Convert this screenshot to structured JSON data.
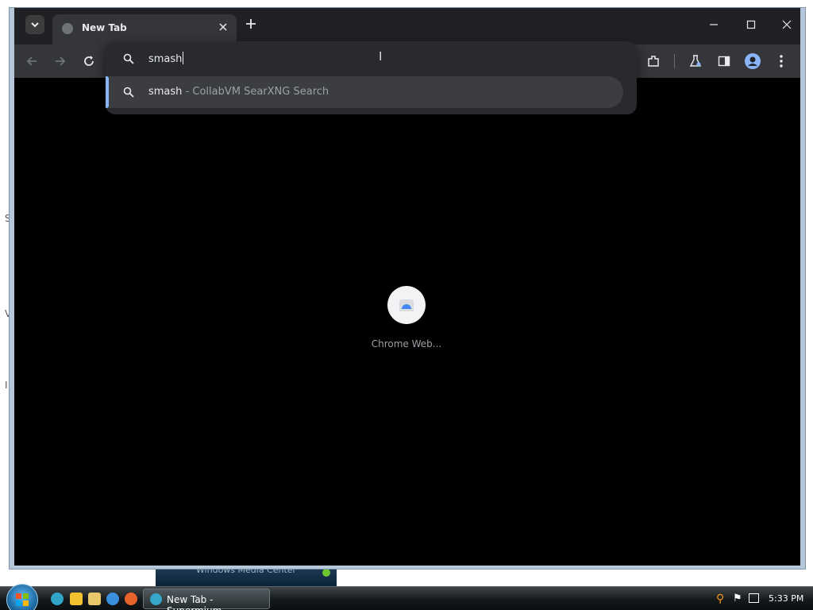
{
  "browser": {
    "tab": {
      "title": "New Tab"
    },
    "omnibox": {
      "value": "smash",
      "suggestion": {
        "query": "smash",
        "description": " - CollabVM SearXNG Search"
      }
    },
    "shortcut": {
      "label": "Chrome Web..."
    }
  },
  "desktop": {
    "edge_glyphs": [
      "S",
      "V",
      "I"
    ],
    "wmc_text": "Windows Media Center"
  },
  "taskbar": {
    "task_button": "New Tab - Supermium",
    "clock": "5:33 PM"
  },
  "colors": {
    "tabstrip": "#202124",
    "toolbar": "#35363a",
    "omnibox": "#282a2d",
    "suggestion_highlight": "#3c3d41",
    "accent": "#8ab4f8",
    "content": "#000000"
  },
  "icons": [
    "tab-search-icon",
    "globe-icon",
    "close-icon",
    "plus-icon",
    "minimize-icon",
    "maximize-icon",
    "back-icon",
    "forward-icon",
    "reload-icon",
    "search-icon",
    "extensions-icon",
    "labs-icon",
    "side-panel-icon",
    "profile-icon",
    "menu-icon",
    "web-store-icon",
    "windows-start-icon"
  ]
}
